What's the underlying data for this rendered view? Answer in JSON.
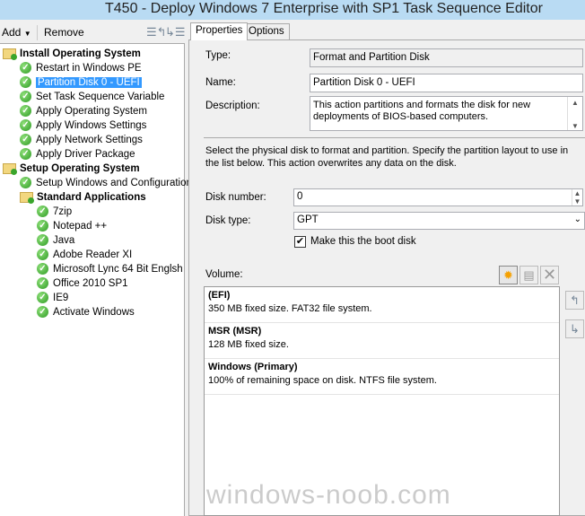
{
  "window": {
    "title": "T450 - Deploy Windows 7 Enterprise with SP1 Task Sequence Editor"
  },
  "toolbar": {
    "add_label": "Add",
    "remove_label": "Remove",
    "icons": [
      "move-up-icon",
      "move-down-icon"
    ]
  },
  "tree": [
    {
      "label": "Install Operating System",
      "type": "group",
      "level": 0
    },
    {
      "label": "Restart in Windows PE",
      "type": "step",
      "level": 1
    },
    {
      "label": "Partition Disk 0 - UEFI",
      "type": "step",
      "level": 1,
      "selected": true
    },
    {
      "label": "Set Task Sequence Variable",
      "type": "step",
      "level": 1
    },
    {
      "label": "Apply Operating System",
      "type": "step",
      "level": 1
    },
    {
      "label": "Apply Windows Settings",
      "type": "step",
      "level": 1
    },
    {
      "label": "Apply Network Settings",
      "type": "step",
      "level": 1
    },
    {
      "label": "Apply Driver Package",
      "type": "step",
      "level": 1
    },
    {
      "label": "Setup Operating System",
      "type": "group",
      "level": 0
    },
    {
      "label": "Setup Windows and Configuration",
      "type": "step",
      "level": 1
    },
    {
      "label": "Standard Applications",
      "type": "group",
      "level": 1
    },
    {
      "label": "7zip",
      "type": "step",
      "level": 2
    },
    {
      "label": "Notepad ++",
      "type": "step",
      "level": 2
    },
    {
      "label": "Java",
      "type": "step",
      "level": 2
    },
    {
      "label": "Adobe Reader XI",
      "type": "step",
      "level": 2
    },
    {
      "label": "Microsoft Lync 64 Bit  Englsh",
      "type": "step",
      "level": 2
    },
    {
      "label": "Office 2010 SP1",
      "type": "step",
      "level": 2
    },
    {
      "label": "IE9",
      "type": "step",
      "level": 2
    },
    {
      "label": "Activate Windows",
      "type": "step",
      "level": 2
    }
  ],
  "tabs": [
    {
      "label": "Properties",
      "active": true
    },
    {
      "label": "Options"
    }
  ],
  "props": {
    "type_label": "Type:",
    "type_value": "Format and Partition Disk",
    "name_label": "Name:",
    "name_value": "Partition Disk 0 - UEFI",
    "desc_label": "Description:",
    "desc_value": "This action partitions and formats the disk for new deployments of BIOS-based computers.",
    "info": "Select the physical disk to format and partition. Specify the partition layout to use in the list below. This action overwrites any data on the disk.",
    "disk_number_label": "Disk number:",
    "disk_number_value": "0",
    "disk_type_label": "Disk type:",
    "disk_type_value": "GPT",
    "boot_label": "Make this the boot disk",
    "boot_checked": true,
    "volume_label": "Volume:",
    "volumes": [
      {
        "name": "(EFI)",
        "desc": "350 MB fixed size. FAT32 file system."
      },
      {
        "name": "MSR (MSR)",
        "desc": "128 MB fixed size."
      },
      {
        "name": "Windows (Primary)",
        "desc": "100% of remaining space on disk. NTFS file system."
      }
    ]
  },
  "watermark": "windows-noob.com"
}
